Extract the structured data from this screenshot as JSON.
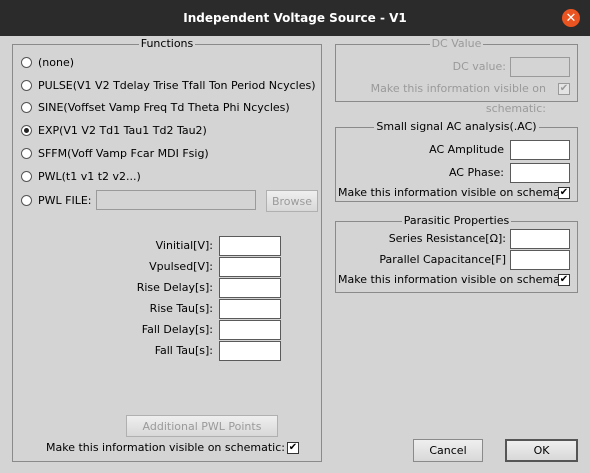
{
  "window": {
    "title": "Independent Voltage Source - V1",
    "close_glyph": "✕"
  },
  "functions": {
    "title": "Functions",
    "options": [
      {
        "label": "(none)",
        "selected": false
      },
      {
        "label": "PULSE(V1 V2 Tdelay Trise Tfall Ton Period Ncycles)",
        "selected": false
      },
      {
        "label": "SINE(Voffset Vamp Freq Td Theta Phi Ncycles)",
        "selected": false
      },
      {
        "label": "EXP(V1 V2 Td1 Tau1 Td2 Tau2)",
        "selected": true
      },
      {
        "label": "SFFM(Voff Vamp Fcar MDI Fsig)",
        "selected": false
      },
      {
        "label": "PWL(t1 v1 t2 v2...)",
        "selected": false
      },
      {
        "label": "PWL FILE:",
        "selected": false
      }
    ],
    "pwl_file_value": "",
    "browse_label": "Browse",
    "params": [
      {
        "label": "Vinitial[V]:",
        "value": ""
      },
      {
        "label": "Vpulsed[V]:",
        "value": ""
      },
      {
        "label": "Rise Delay[s]:",
        "value": ""
      },
      {
        "label": "Rise Tau[s]:",
        "value": ""
      },
      {
        "label": "Fall Delay[s]:",
        "value": ""
      },
      {
        "label": "Fall Tau[s]:",
        "value": ""
      }
    ],
    "additional_pwl_label": "Additional PWL Points",
    "visible_label": "Make this information visible on schematic:",
    "visible_checked": true
  },
  "dc_value": {
    "title": "DC Value",
    "label": "DC value:",
    "value": "",
    "visible_label": "Make this information visible on schematic:",
    "visible_checked": true
  },
  "ac": {
    "title": "Small signal AC analysis(.AC)",
    "amplitude_label": "AC Amplitude",
    "amplitude_value": "",
    "phase_label": "AC Phase:",
    "phase_value": "",
    "visible_label": "Make this information visible on schematic:",
    "visible_checked": true
  },
  "parasitic": {
    "title": "Parasitic Properties",
    "series_label": "Series Resistance[Ω]:",
    "series_value": "",
    "parallel_label": "Parallel Capacitance[F]",
    "parallel_value": "",
    "visible_label": "Make this information visible on schematic:",
    "visible_checked": true
  },
  "buttons": {
    "cancel": "Cancel",
    "ok": "OK"
  },
  "check_glyph": "✔"
}
